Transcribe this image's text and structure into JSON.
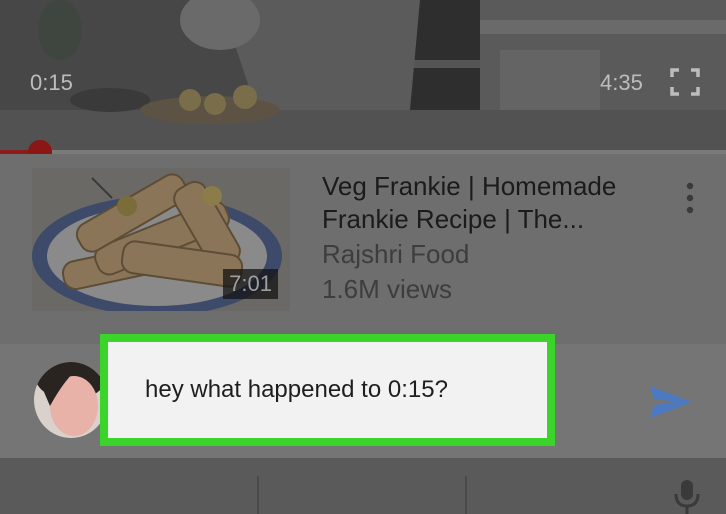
{
  "player": {
    "current_time": "0:15",
    "total_time": "4:35",
    "progress_fraction": 0.055
  },
  "suggestion": {
    "title": "Veg Frankie | Homemade Frankie Recipe | The...",
    "channel": "Rajshri Food",
    "views": "1.6M views",
    "duration": "7:01"
  },
  "chat": {
    "message": "hey what happened to 0:15?"
  },
  "colors": {
    "progress": "#8c1c1c",
    "highlight": "#3bd42b",
    "send": "#4c79c0"
  },
  "icons": [
    "fullscreen-icon",
    "more-vertical-icon",
    "send-icon",
    "microphone-icon"
  ]
}
